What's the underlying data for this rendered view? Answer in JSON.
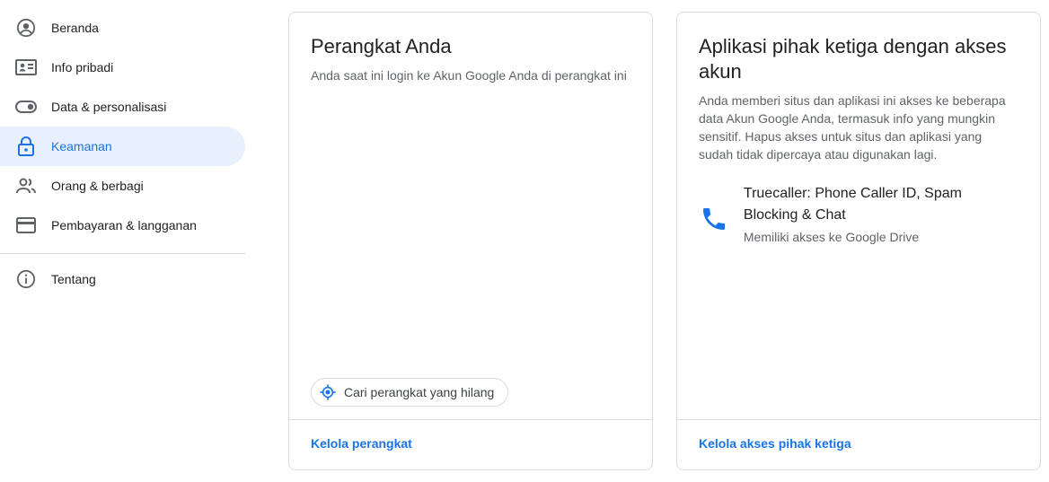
{
  "sidebar": {
    "items": [
      {
        "label": "Beranda",
        "icon": "account-circle-icon"
      },
      {
        "label": "Info pribadi",
        "icon": "id-card-icon"
      },
      {
        "label": "Data & personalisasi",
        "icon": "toggle-icon"
      },
      {
        "label": "Keamanan",
        "icon": "lock-icon",
        "active": true
      },
      {
        "label": "Orang & berbagi",
        "icon": "people-icon"
      },
      {
        "label": "Pembayaran & langganan",
        "icon": "credit-card-icon"
      },
      {
        "label": "Tentang",
        "icon": "info-icon"
      }
    ]
  },
  "devices_card": {
    "title": "Perangkat Anda",
    "description": "Anda saat ini login ke Akun Google Anda di perangkat ini",
    "find_button": "Cari perangkat yang hilang",
    "footer_link": "Kelola perangkat"
  },
  "third_party_card": {
    "title": "Aplikasi pihak ketiga dengan akses akun",
    "description": "Anda memberi situs dan aplikasi ini akses ke beberapa data Akun Google Anda, termasuk info yang mungkin sensitif. Hapus akses untuk situs dan aplikasi yang sudah tidak dipercaya atau digunakan lagi.",
    "apps": [
      {
        "name": "Truecaller: Phone Caller ID, Spam Blocking & Chat",
        "access": "Memiliki akses ke Google Drive",
        "icon": "phone-icon"
      }
    ],
    "footer_link": "Kelola akses pihak ketiga"
  },
  "colors": {
    "accent": "#1a73e8",
    "active_bg": "#e8f0fe",
    "border": "#dadce0"
  }
}
